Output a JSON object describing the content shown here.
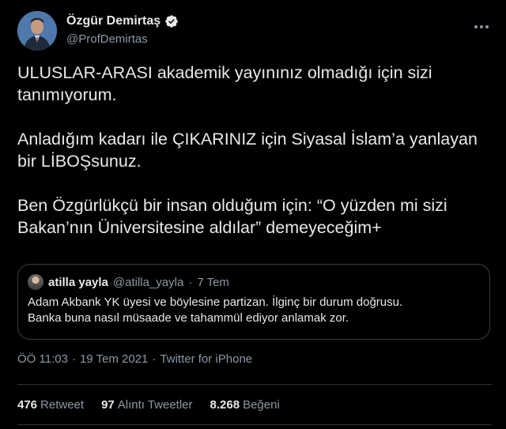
{
  "author": {
    "display_name": "Özgür Demirtaş",
    "handle": "@ProfDemirtas",
    "verified": true,
    "avatar_icon": "profile-photo"
  },
  "tweet": {
    "paragraphs": [
      "ULUSLAR-ARASI akademik yayınınız olmadığı için sizi tanımıyorum.",
      "Anladığım kadarı ile ÇIKARINIZ için Siyasal İslam’a yanlayan bir LİBOŞsunuz.",
      "Ben Özgürlükçü bir insan olduğum için: “O yüzden mi sizi Bakan’nın Üniversitesine aldılar” demeyeceğim+"
    ]
  },
  "quote": {
    "name": "atilla yayla",
    "handle": "@atilla_yayla",
    "dot": "·",
    "time": "7 Tem",
    "line1": "Adam Akbank YK üyesi ve böylesine partizan. İlginç bir durum doğrusu.",
    "line2": "Banka buna nasıl müsaade ve tahammül ediyor anlamak zor."
  },
  "meta": {
    "time": "ÖÖ 11:03",
    "sep": "·",
    "date": "19 Tem 2021",
    "source": "Twitter for iPhone"
  },
  "stats": {
    "retweets_count": "476",
    "retweets_label": "Retweet",
    "quotes_count": "97",
    "quotes_label": "Alıntı Tweetler",
    "likes_count": "8.268",
    "likes_label": "Beğeni"
  },
  "colors": {
    "background": "#000000",
    "text": "#e7e9ea",
    "secondary": "#8b98a5",
    "verified": "#1d9bf0",
    "border": "#2f3336"
  }
}
